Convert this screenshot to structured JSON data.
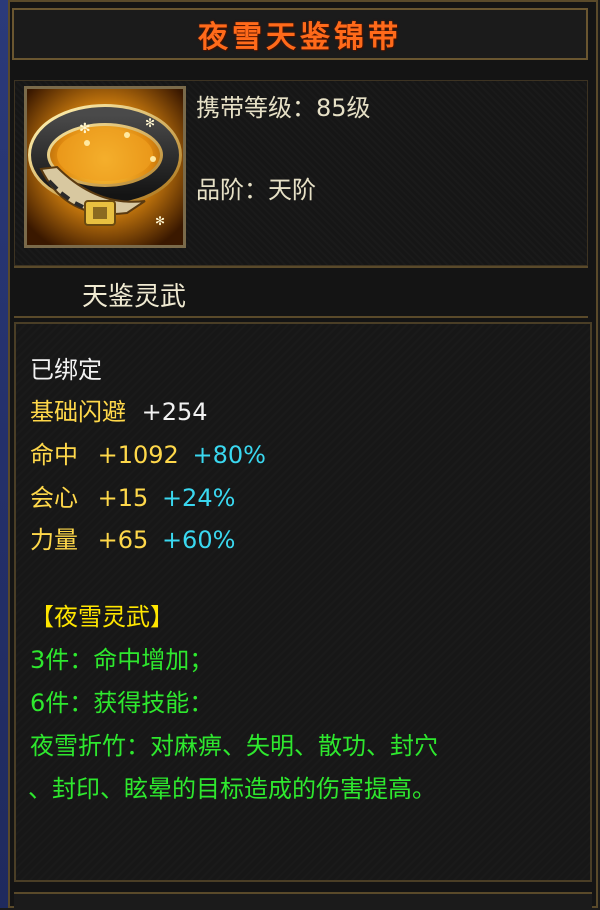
{
  "title": "夜雪天鉴锦带",
  "item": {
    "icon": "belt-icon",
    "carry_level_label": "携带等级：",
    "carry_level_value": "85级",
    "grade_label": "品阶：",
    "grade_value": "天阶"
  },
  "series_name": "天鉴灵武",
  "details": {
    "bound": "已绑定",
    "base_dodge_label": "基础闪避",
    "base_dodge_value": "+254",
    "stats": [
      {
        "name": "命中",
        "value": "+1092",
        "bonus": "+80%"
      },
      {
        "name": "会心",
        "value": "+15",
        "bonus": "+24%"
      },
      {
        "name": "力量",
        "value": "+65",
        "bonus": "+60%"
      }
    ],
    "set_title": "【夜雪灵武】",
    "set_lines": [
      "3件：命中增加；",
      "6件：获得技能：",
      "夜雪折竹：对麻痹、失明、散功、封穴",
      "、封印、眩晕的目标造成的伤害提高。"
    ]
  },
  "colors": {
    "title": "#ff6a1a",
    "stat_name": "#ffd84a",
    "bonus": "#3ad8f0",
    "set_text": "#2ee82e",
    "set_title": "#ffe600"
  }
}
